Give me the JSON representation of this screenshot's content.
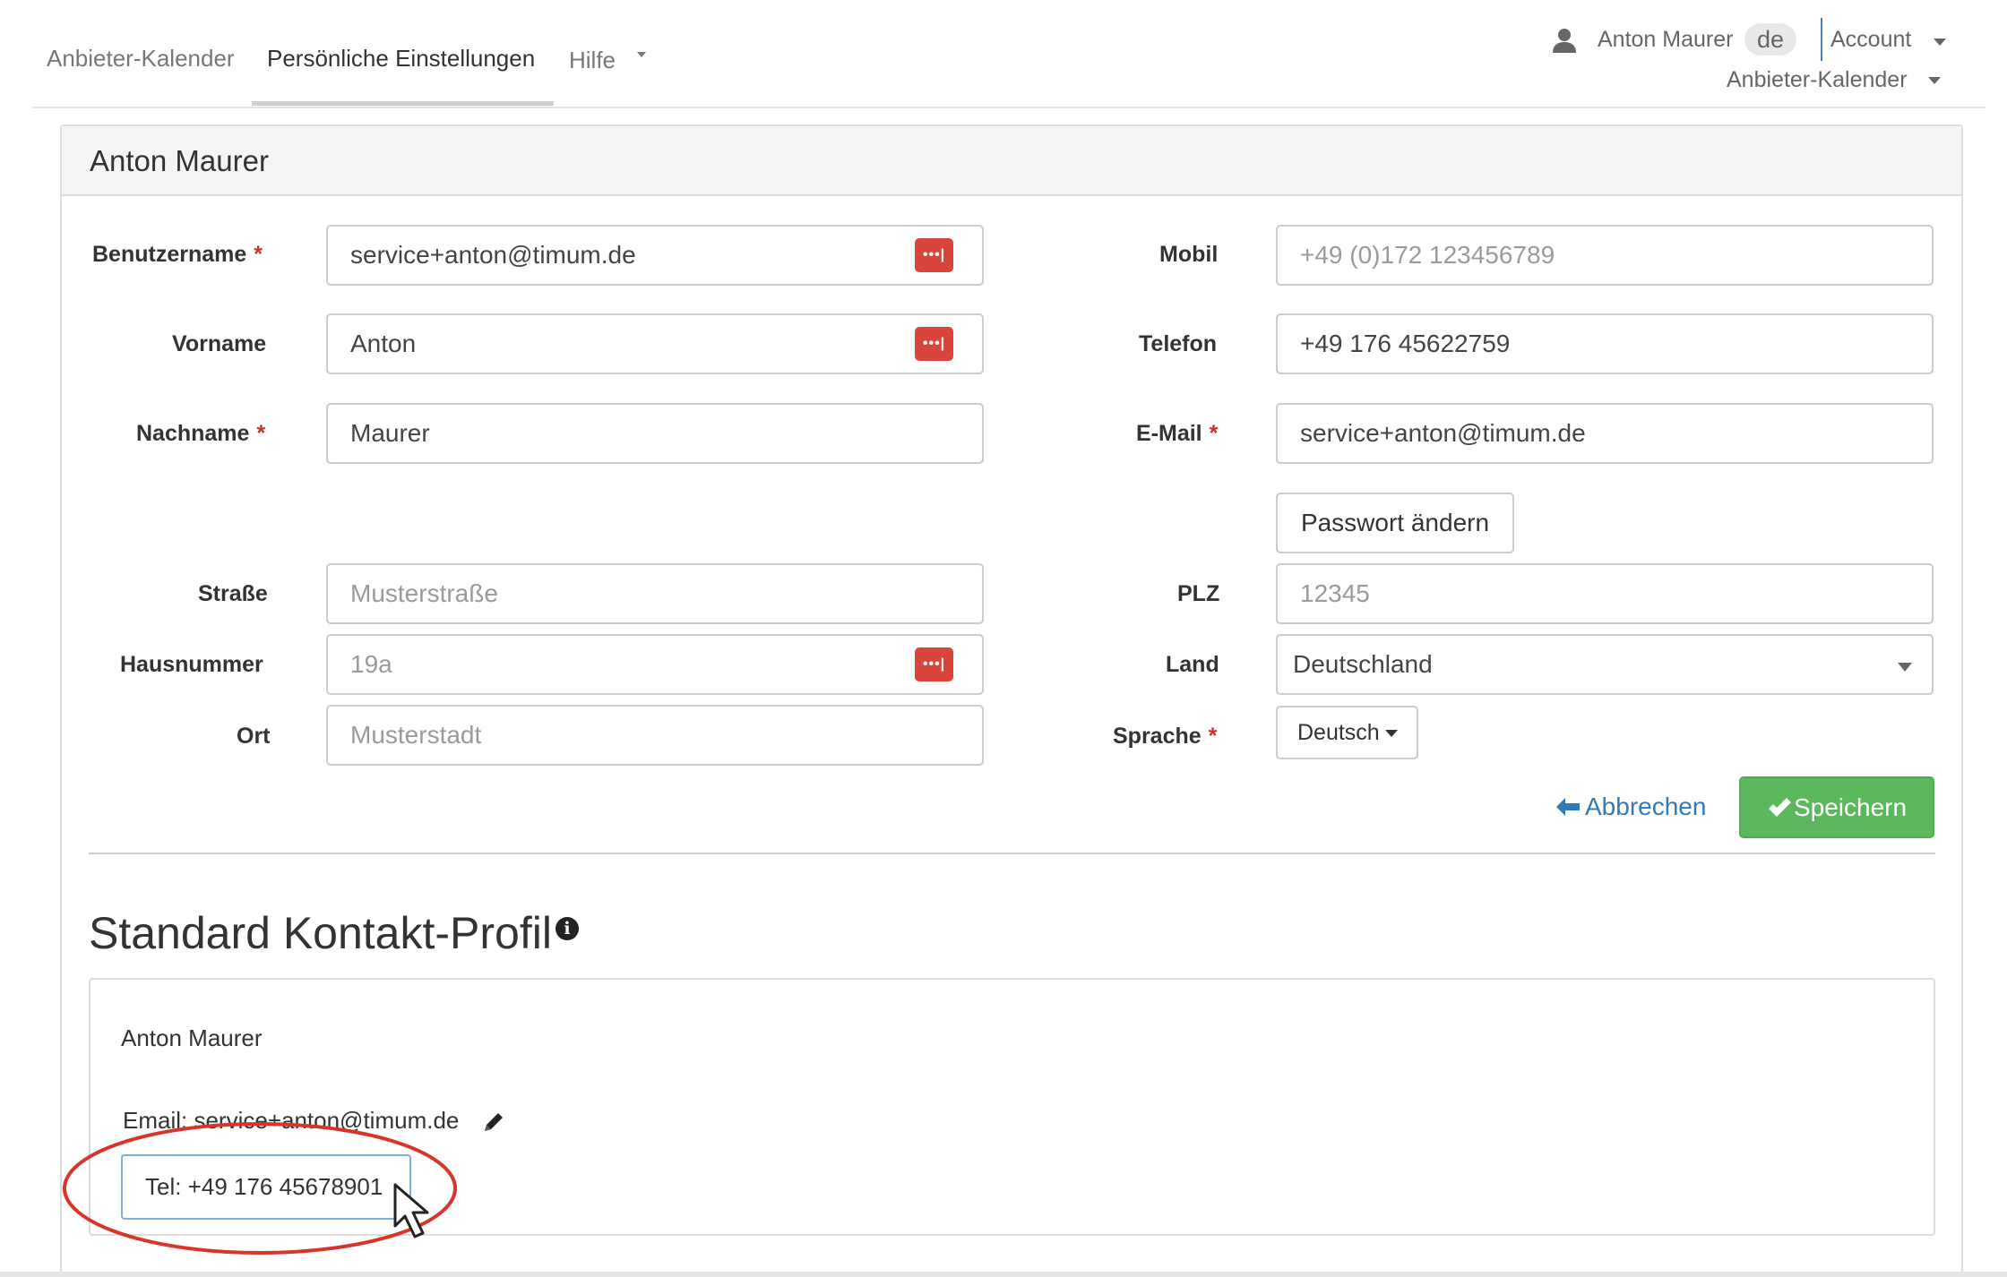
{
  "nav": {
    "tabs": [
      {
        "label": "Anbieter-Kalender"
      },
      {
        "label": "Persönliche Einstellungen",
        "active": true
      },
      {
        "label": "Hilfe"
      }
    ]
  },
  "user_menu": {
    "user_name": "Anton Maurer",
    "language": "de",
    "account_label": "Account",
    "calendar_label": "Anbieter-Kalender"
  },
  "panel": {
    "title": "Anton Maurer"
  },
  "form": {
    "username": {
      "label": "Benutzername",
      "value": "service+anton@timum.de"
    },
    "firstname": {
      "label": "Vorname",
      "value": "Anton"
    },
    "lastname": {
      "label": "Nachname",
      "value": "Maurer"
    },
    "street": {
      "label": "Straße",
      "placeholder": "Musterstraße"
    },
    "housenumber": {
      "label": "Hausnummer",
      "placeholder": "19a"
    },
    "city": {
      "label": "Ort",
      "placeholder": "Musterstadt"
    },
    "mobile": {
      "label": "Mobil",
      "placeholder": "+49 (0)172 123456789"
    },
    "phone": {
      "label": "Telefon",
      "value": "+49 176 45622759"
    },
    "email": {
      "label": "E-Mail",
      "value": "service+anton@timum.de"
    },
    "change_password_label": "Passwort ändern",
    "zip": {
      "label": "PLZ",
      "placeholder": "12345"
    },
    "country": {
      "label": "Land",
      "value": "Deutschland"
    },
    "language": {
      "label": "Sprache",
      "value": "Deutsch"
    },
    "required_marker": "*",
    "cancel_label": "Abbrechen",
    "save_label": "Speichern"
  },
  "contact_profile": {
    "title": "Standard Kontakt-Profil",
    "info_icon": "i",
    "name": "Anton Maurer",
    "email_line": "Email: service+anton@timum.de",
    "tel_line": "Tel: +49 176 45678901"
  },
  "colors": {
    "required": "#c9302c",
    "password_manager_icon": "#d9453b",
    "link": "#337ab7",
    "save_button": "#5cb85c",
    "highlight_ellipse": "#d9342b",
    "focus_border": "#80aee0"
  },
  "icons": {
    "user": "person-icon",
    "password_manager": "password-manager-icon",
    "cancel": "arrow-left-icon",
    "save": "checkmark-icon",
    "info": "info-icon",
    "edit": "pencil-icon",
    "cursor": "mouse-cursor-icon"
  }
}
